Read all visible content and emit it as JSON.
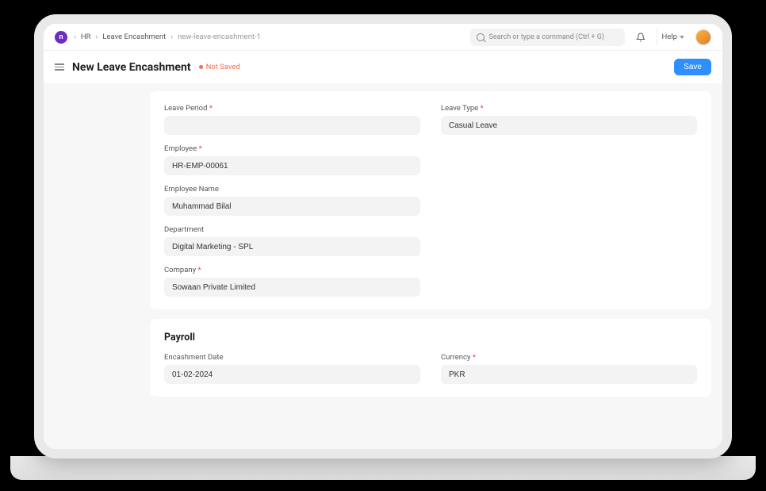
{
  "breadcrumbs": {
    "items": [
      "HR",
      "Leave Encashment"
    ],
    "current": "new-leave-encashment-1"
  },
  "search": {
    "placeholder": "Search or type a command (Ctrl + G)"
  },
  "help_label": "Help",
  "page": {
    "title": "New Leave Encashment",
    "status": "Not Saved",
    "save_label": "Save"
  },
  "form": {
    "leave_period": {
      "label": "Leave Period",
      "value": ""
    },
    "leave_type": {
      "label": "Leave Type",
      "value": "Casual Leave"
    },
    "employee": {
      "label": "Employee",
      "value": "HR-EMP-00061"
    },
    "employee_name": {
      "label": "Employee Name",
      "value": "Muhammad Bilal"
    },
    "department": {
      "label": "Department",
      "value": "Digital Marketing - SPL"
    },
    "company": {
      "label": "Company",
      "value": "Sowaan Private Limited"
    }
  },
  "payroll": {
    "section_title": "Payroll",
    "encashment_date": {
      "label": "Encashment Date",
      "value": "01-02-2024"
    },
    "currency": {
      "label": "Currency",
      "value": "PKR"
    }
  }
}
